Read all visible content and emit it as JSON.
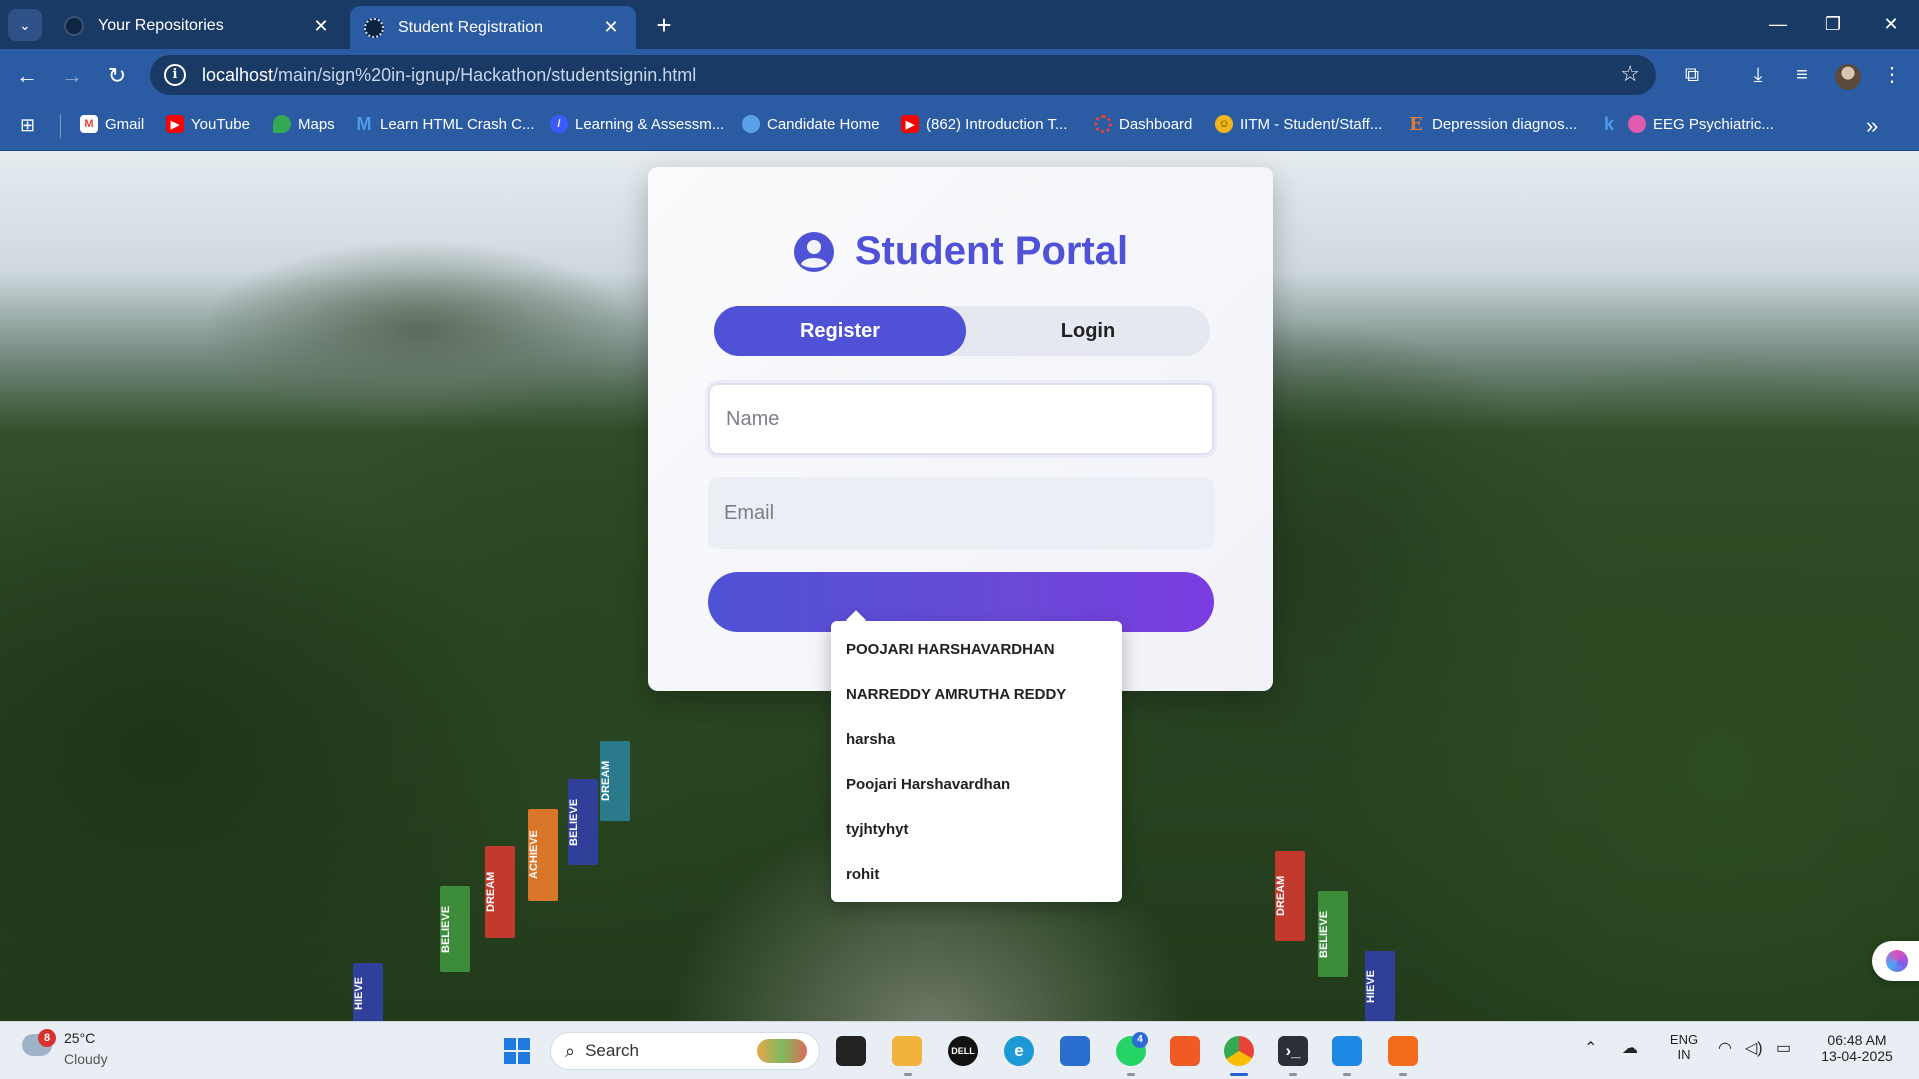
{
  "browser": {
    "tabs": [
      {
        "title": "Your Repositories",
        "icon": "github-icon",
        "active": false
      },
      {
        "title": "Student Registration",
        "icon": "student-icon",
        "active": true
      }
    ],
    "url_host": "localhost",
    "url_path": "/main/sign%20in-ignup/Hackathon/studentsignin.html",
    "bookmarks": [
      {
        "label": "Gmail",
        "icon": "gmail-icon",
        "color": "#ea4335"
      },
      {
        "label": "YouTube",
        "icon": "youtube-icon",
        "color": "#ff0000"
      },
      {
        "label": "Maps",
        "icon": "maps-icon",
        "color": "#34a853"
      },
      {
        "label": "Learn HTML Crash C...",
        "icon": "m-icon",
        "color": "#4c9be8"
      },
      {
        "label": "Learning & Assessm...",
        "icon": "learning-icon",
        "color": "#3d5afe"
      },
      {
        "label": "Candidate Home",
        "icon": "candidate-icon",
        "color": "#5aa0e8"
      },
      {
        "label": "(862) Introduction T...",
        "icon": "youtube-icon",
        "color": "#ff0000"
      },
      {
        "label": "Dashboard",
        "icon": "dashboard-icon",
        "color": "#e0443a"
      },
      {
        "label": "IITM - Student/Staff...",
        "icon": "emoji-icon",
        "color": "#f2b51c"
      },
      {
        "label": "Depression diagnos...",
        "icon": "e-icon",
        "color": "#e07a3a"
      },
      {
        "label": "EEG Psychiatric...",
        "icon": "brain-icon",
        "color": "#e05ab0"
      }
    ]
  },
  "page": {
    "title": "Student Portal",
    "tabs": {
      "register": "Register",
      "login": "Login"
    },
    "name_placeholder": "Name",
    "email_placeholder": "Email",
    "suggestions": [
      "POOJARI HARSHAVARDHAN",
      "NARREDDY AMRUTHA REDDY",
      "harsha",
      "Poojari Harshavardhan",
      "tyjhtyhyt",
      "rohit"
    ],
    "banners": [
      "DREAM",
      "ACHIEVE",
      "BELIEVE",
      "BELIEVE",
      "DREAM",
      "BELIEVE",
      "HIEVE",
      "DREAM",
      "BELIEVE",
      "HIEVE"
    ],
    "accent": "#4f52d6"
  },
  "taskbar": {
    "weather_temp": "25°C",
    "weather_desc": "Cloudy",
    "weather_badge": "8",
    "search": "Search",
    "whatsapp_badge": "4",
    "lang_top": "ENG",
    "lang_bottom": "IN",
    "time": "06:48 AM",
    "date": "13-04-2025"
  }
}
